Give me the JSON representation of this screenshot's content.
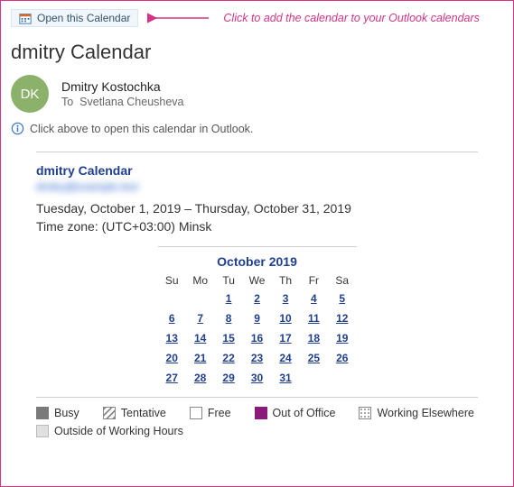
{
  "toolbar": {
    "open_calendar_label": "Open this Calendar"
  },
  "annotation": {
    "hint": "Click to add the calendar to your Outlook calendars"
  },
  "header": {
    "title": "dmitry Calendar"
  },
  "sender": {
    "initials": "DK",
    "name": "Dmitry Kostochka",
    "to_label": "To",
    "recipient": "Svetlana Cheusheva"
  },
  "info_bar": {
    "text": "Click above to open this calendar in Outlook."
  },
  "panel": {
    "calendar_name": "dmitry Calendar",
    "owner_email": "dmitry@example.test",
    "date_range": "Tuesday, October 1, 2019 – Thursday, October 31, 2019",
    "timezone": "Time zone: (UTC+03:00) Minsk"
  },
  "calendar": {
    "title": "October 2019",
    "weekdays": [
      "Su",
      "Mo",
      "Tu",
      "We",
      "Th",
      "Fr",
      "Sa"
    ],
    "weeks": [
      [
        "",
        "",
        "1",
        "2",
        "3",
        "4",
        "5"
      ],
      [
        "6",
        "7",
        "8",
        "9",
        "10",
        "11",
        "12"
      ],
      [
        "13",
        "14",
        "15",
        "16",
        "17",
        "18",
        "19"
      ],
      [
        "20",
        "21",
        "22",
        "23",
        "24",
        "25",
        "26"
      ],
      [
        "27",
        "28",
        "29",
        "30",
        "31",
        "",
        ""
      ]
    ]
  },
  "legend": {
    "busy": "Busy",
    "tentative": "Tentative",
    "free": "Free",
    "out_of_office": "Out of Office",
    "working_elsewhere": "Working Elsewhere",
    "outside_hours": "Outside of Working Hours"
  },
  "colors": {
    "accent": "#1f3f8f",
    "annotation": "#d63384"
  }
}
